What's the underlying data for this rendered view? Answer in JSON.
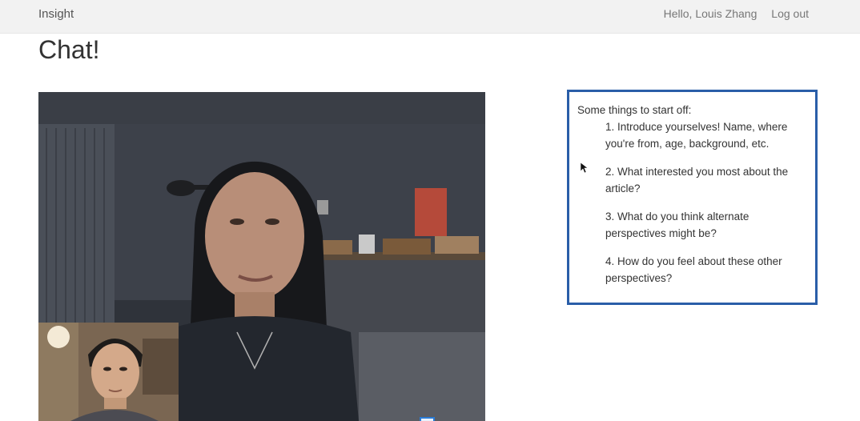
{
  "navbar": {
    "brand": "Insight",
    "greeting": "Hello, Louis Zhang",
    "logout": "Log out"
  },
  "page": {
    "title": "Chat!"
  },
  "video": {
    "remote_label": "remote-video-feed",
    "self_label": "self-video-preview"
  },
  "prompts": {
    "intro": "Some things to start off:",
    "items": [
      "1. Introduce yourselves! Name, where you're from, age, background, etc.",
      "2. What interested you most about the article?",
      "3. What do you think alternate perspectives might be?",
      "4. How do you feel about these other perspectives?"
    ]
  },
  "colors": {
    "navbar_bg": "#f2f2f2",
    "prompt_border": "#2a5ea8",
    "text": "#333333"
  }
}
